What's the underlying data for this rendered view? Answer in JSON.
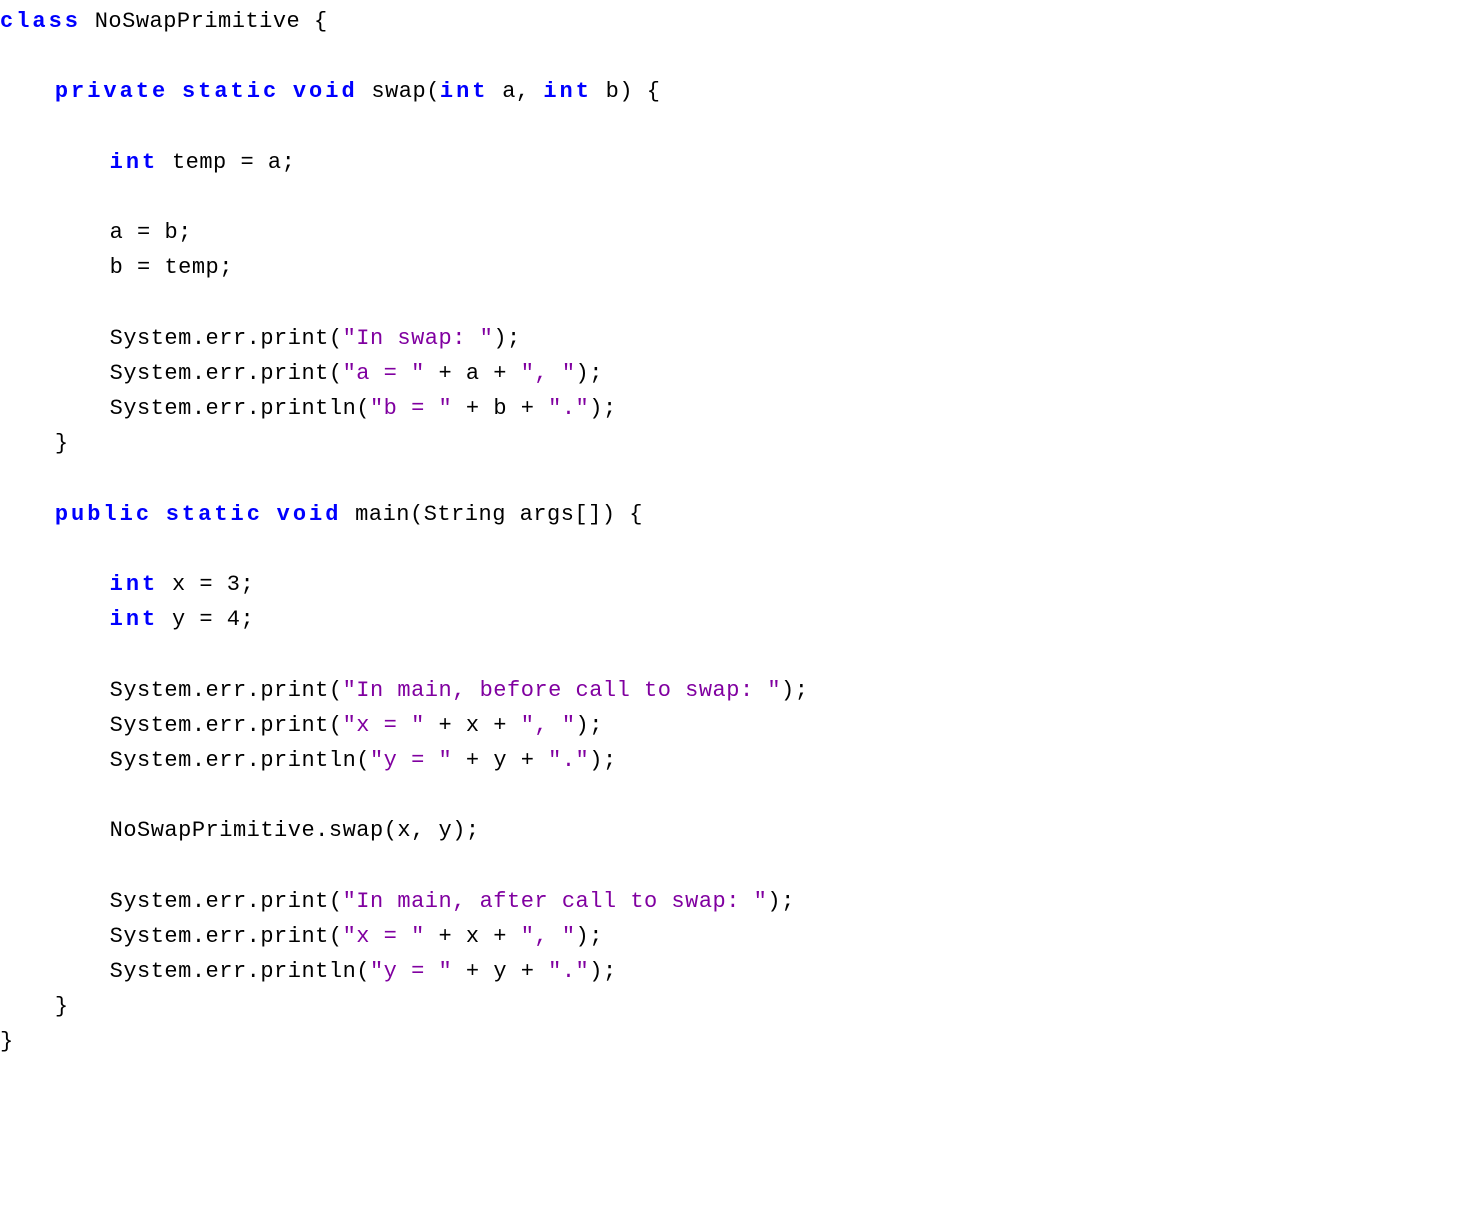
{
  "code": {
    "keywords": {
      "class": "class",
      "private": "private",
      "static": "static",
      "void": "void",
      "int": "int",
      "public": "public"
    },
    "identifiers": {
      "className": "NoSwapPrimitive",
      "swap": "swap",
      "a": "a",
      "b": "b",
      "temp": "temp",
      "System": "System",
      "err": "err",
      "print": "print",
      "println": "println",
      "main": "main",
      "String": "String",
      "args": "args",
      "x": "x",
      "y": "y"
    },
    "strings": {
      "inSwap": "\"In swap: \"",
      "aEq": "\"a = \"",
      "commaSp": "\", \"",
      "bEq": "\"b = \"",
      "dot": "\".\"",
      "inMainBefore": "\"In main, before call to swap: \"",
      "xEq": "\"x = \"",
      "yEq": "\"y = \"",
      "inMainAfter": "\"In main, after call to swap: \""
    },
    "literals": {
      "three": "3",
      "four": "4"
    },
    "punct": {
      "openBrace": " {",
      "closeBrace": "}",
      "openParen": "(",
      "closeParen": ")",
      "comma": ",",
      "semicolon": ";",
      "eq": " = ",
      "plus": " + ",
      "dot": ".",
      "brackets": "[]"
    }
  }
}
